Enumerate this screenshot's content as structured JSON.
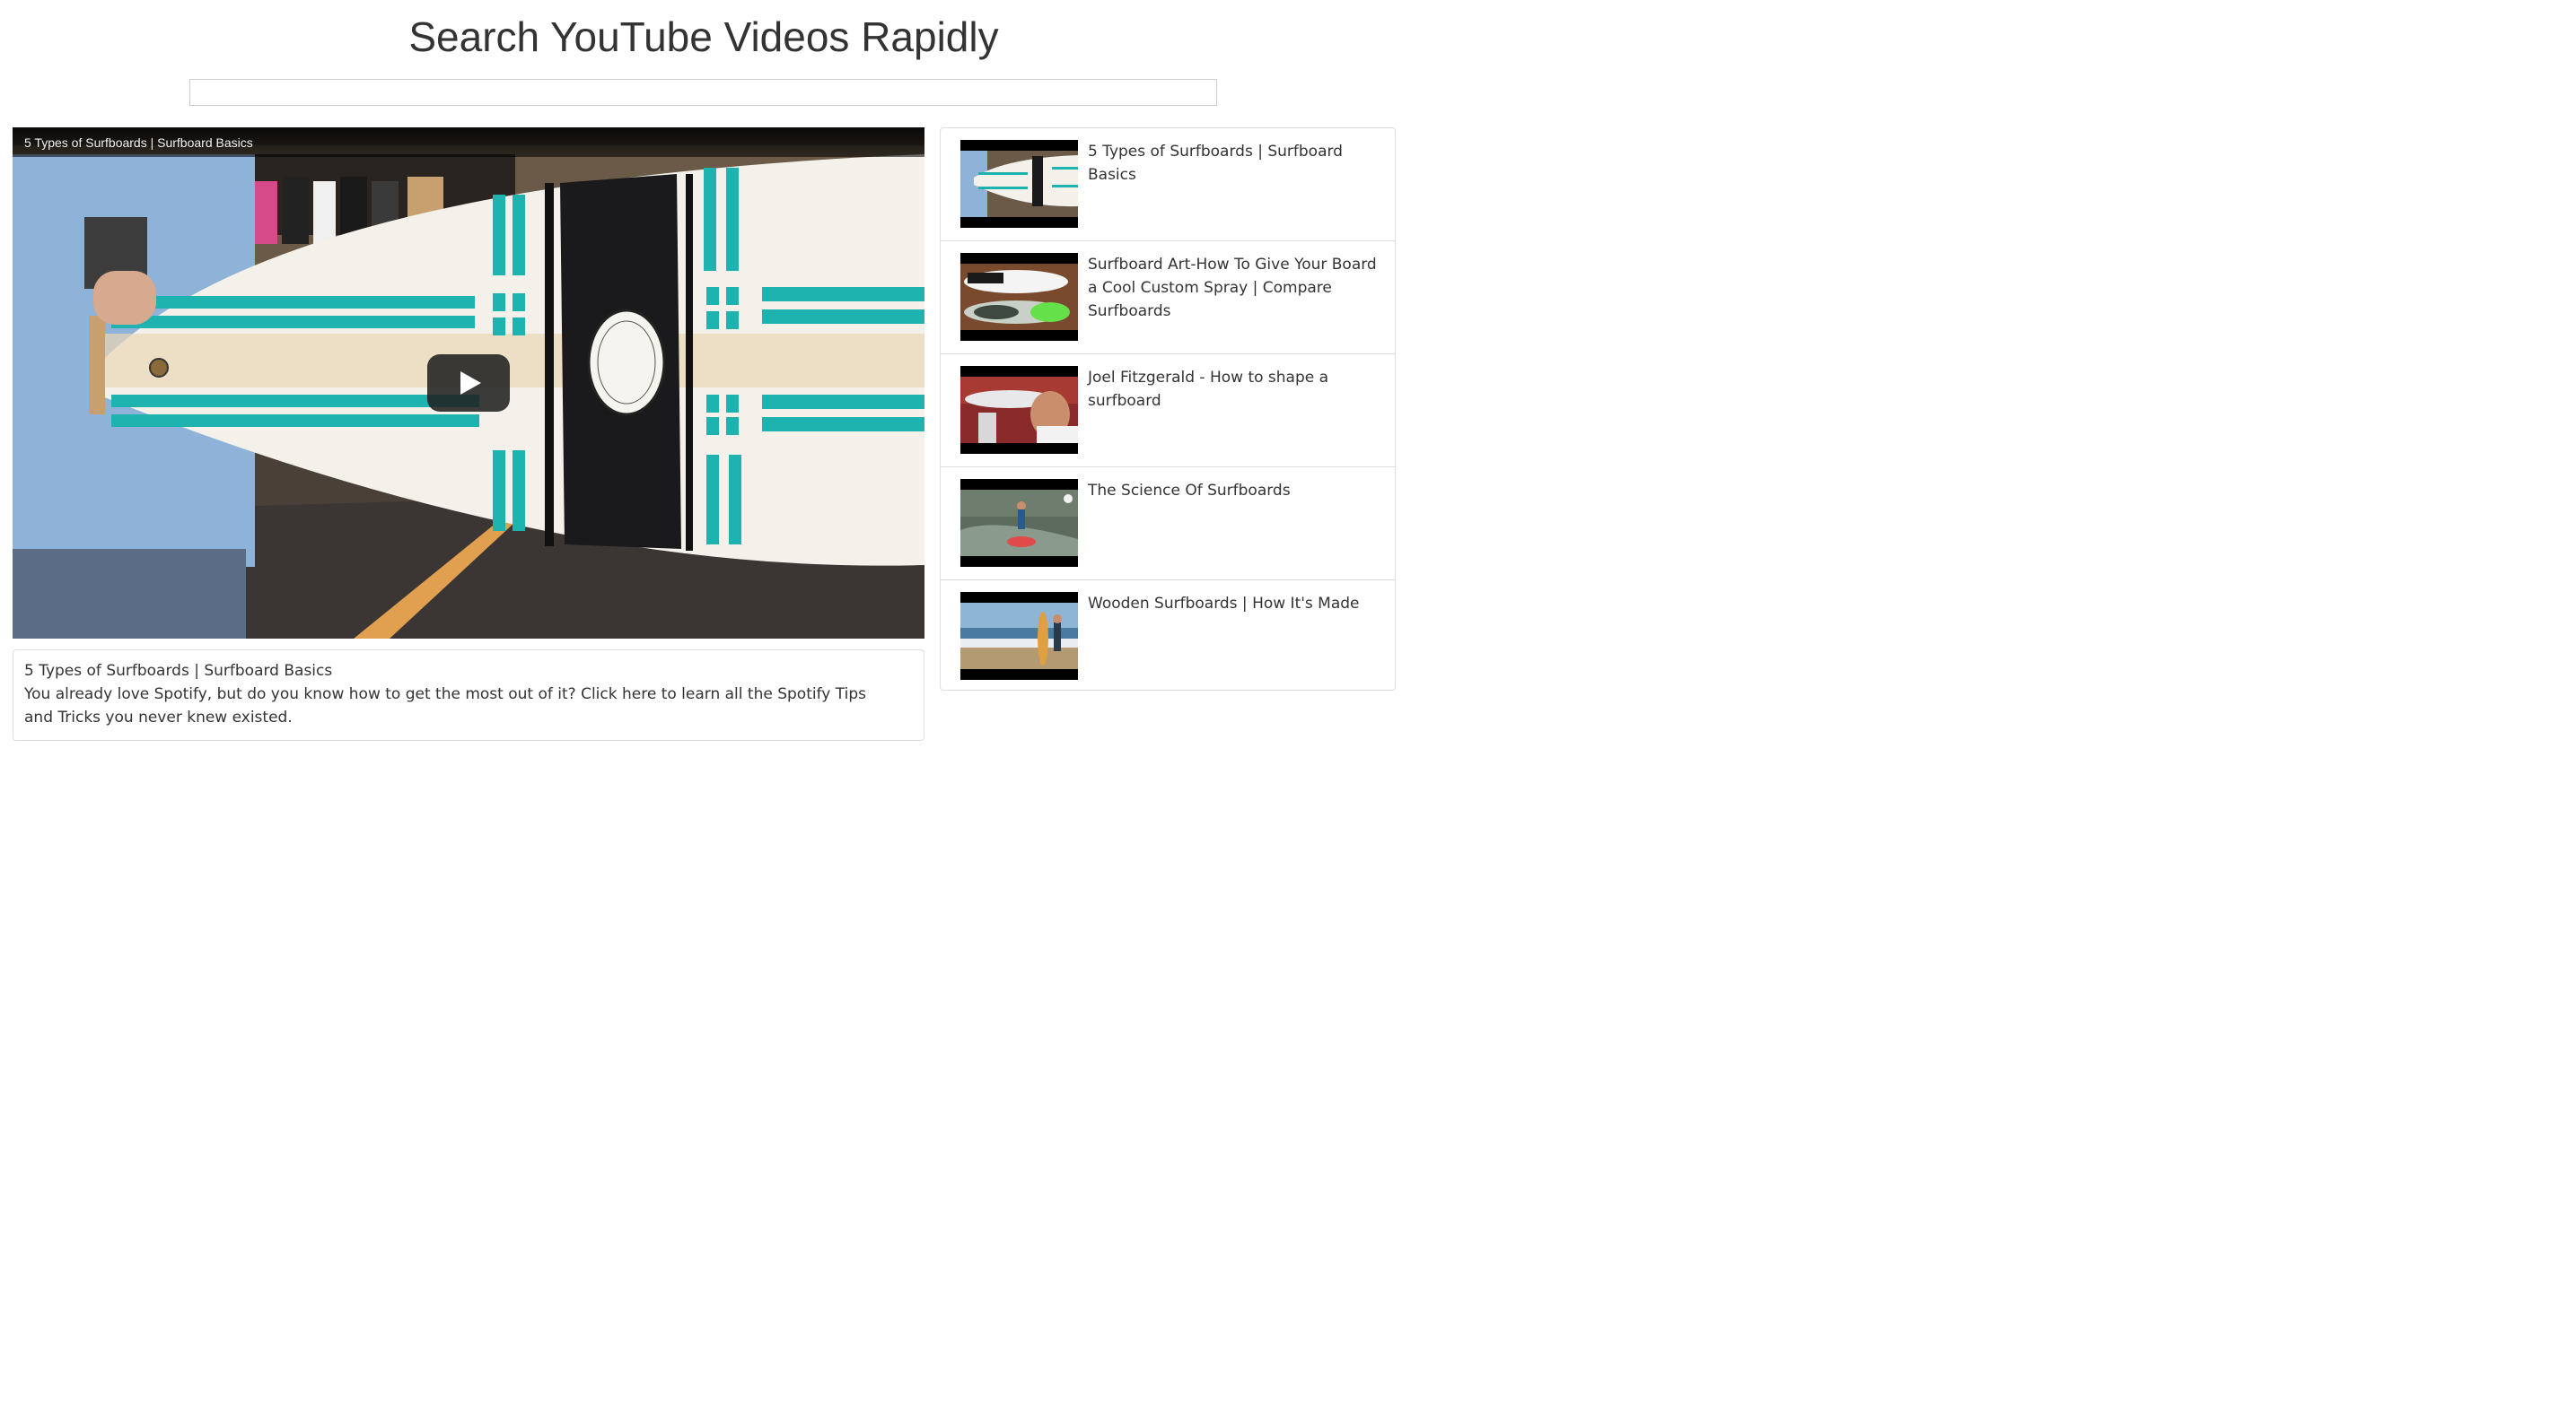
{
  "header": {
    "title": "Search YouTube Videos Rapidly"
  },
  "search": {
    "value": "",
    "placeholder": ""
  },
  "player": {
    "overlay_title": "5 Types of Surfboards | Surfboard Basics",
    "play_icon": "play-icon"
  },
  "details": {
    "title": "5 Types of Surfboards | Surfboard Basics",
    "description": "You already love Spotify, but do you know how to get the most out of it? Click here to learn all the Spotify Tips and Tricks you never knew existed."
  },
  "related": [
    {
      "title": "5 Types of Surfboards | Surfboard Basics"
    },
    {
      "title": "Surfboard Art-How To Give Your Board a Cool Custom Spray | Compare Surfboards"
    },
    {
      "title": "Joel Fitzgerald - How to shape a surfboard"
    },
    {
      "title": "The Science Of Surfboards"
    },
    {
      "title": "Wooden Surfboards | How It's Made"
    }
  ],
  "colors": {
    "text": "#333333",
    "border": "#dddddd",
    "teal_stripe": "#1fb3b0",
    "board": "#f3f1ea"
  }
}
